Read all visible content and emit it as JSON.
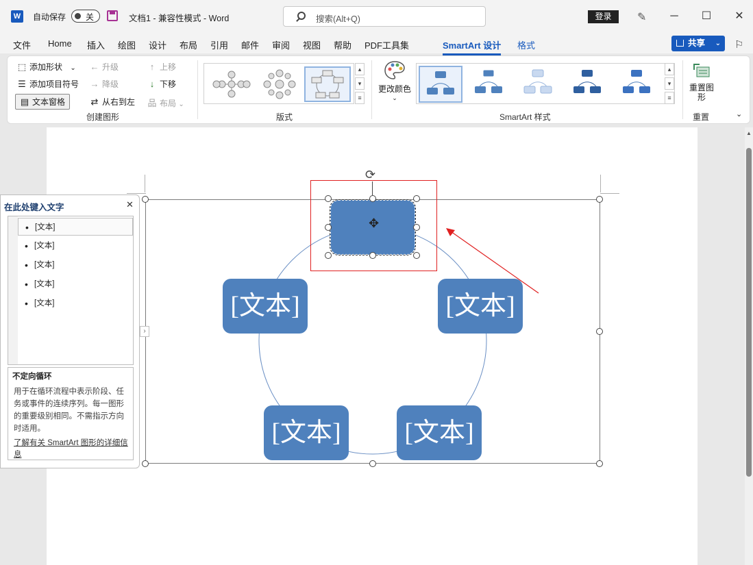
{
  "titlebar": {
    "autosave_label": "自动保存",
    "autosave_state": "关",
    "doc_title": "文档1  -  兼容性模式  -  Word",
    "search_placeholder": "搜索(Alt+Q)",
    "login": "登录"
  },
  "tabs": [
    "文件",
    "Home",
    "插入",
    "绘图",
    "设计",
    "布局",
    "引用",
    "邮件",
    "审阅",
    "视图",
    "帮助",
    "PDF工具集",
    "SmartArt 设计",
    "格式"
  ],
  "share": "共享",
  "ribbon": {
    "create_graphic": {
      "add_shape": "添加形状",
      "add_bullet": "添加项目符号",
      "text_pane": "文本窗格",
      "promote": "升级",
      "demote": "降级",
      "right_to_left": "从右到左",
      "move_up": "上移",
      "move_down": "下移",
      "layout": "布局",
      "label": "创建图形"
    },
    "layouts": {
      "label": "版式"
    },
    "styles": {
      "change_colors": "更改颜色",
      "label": "SmartArt 样式"
    },
    "reset": {
      "reset_graphic": "重置图形",
      "label": "重置"
    }
  },
  "text_pane": {
    "title": "在此处键入文字",
    "items": [
      "[文本]",
      "[文本]",
      "[文本]",
      "[文本]",
      "[文本]"
    ],
    "desc_title": "不定向循环",
    "desc_body": "用于在循环流程中表示阶段、任务或事件的连续序列。每一图形的重要级别相同。不需指示方向时适用。",
    "learn_more": "了解有关 SmartArt 图形的详细信息"
  },
  "smartart": {
    "nodes": [
      "",
      "[文本]",
      "[文本]",
      "[文本]",
      "[文本]"
    ],
    "accent_color": "#4f81bd"
  },
  "colors": {
    "brand": "#185abd",
    "highlight": "#e02020"
  }
}
